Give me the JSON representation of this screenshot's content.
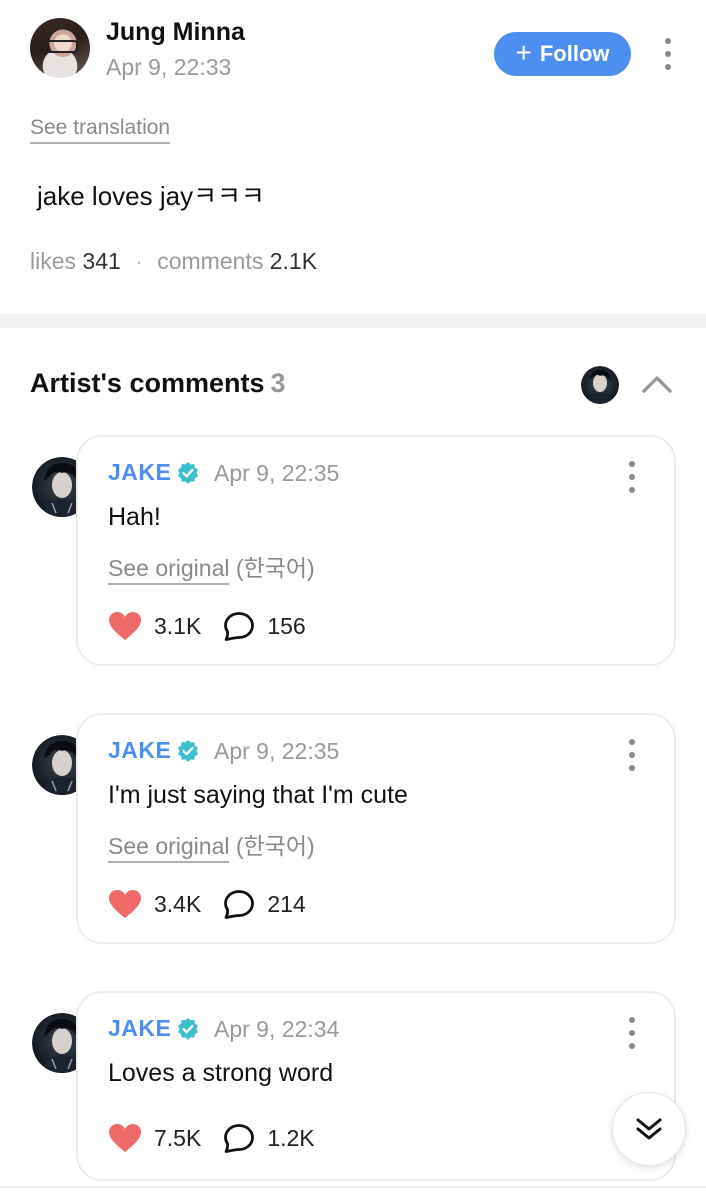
{
  "post": {
    "author": "Jung Minna",
    "date": "Apr 9, 22:33",
    "follow_label": "Follow",
    "see_translation": "See translation",
    "text": "jake loves jayㅋㅋㅋ",
    "likes_label": "likes",
    "likes_count": "341",
    "comments_label": "comments",
    "comments_count": "2.1K"
  },
  "artist_section": {
    "title": "Artist's comments",
    "count": "3"
  },
  "comments": [
    {
      "name": "JAKE",
      "date": "Apr 9, 22:35",
      "text": "Hah!",
      "see_original": "See original",
      "language": "(한국어)",
      "likes": "3.1K",
      "replies": "156"
    },
    {
      "name": "JAKE",
      "date": "Apr 9, 22:35",
      "text": "I'm just saying that I'm cute",
      "see_original": "See original",
      "language": "(한국어)",
      "likes": "3.4K",
      "replies": "214"
    },
    {
      "name": "JAKE",
      "date": "Apr 9, 22:34",
      "text": "Loves a strong word",
      "likes": "7.5K",
      "replies": "1.2K"
    }
  ],
  "colors": {
    "accent": "#4c8ff0",
    "heart": "#f06a6a",
    "verified": "#3cc0d0",
    "muted": "#9a9a9a"
  },
  "icons": {
    "follow": "plus-icon",
    "more": "more-vertical-icon",
    "collapse": "chevron-up-icon",
    "verified": "verified-badge-icon",
    "like": "heart-icon",
    "reply": "speech-bubble-icon",
    "scroll": "double-chevron-down-icon"
  }
}
